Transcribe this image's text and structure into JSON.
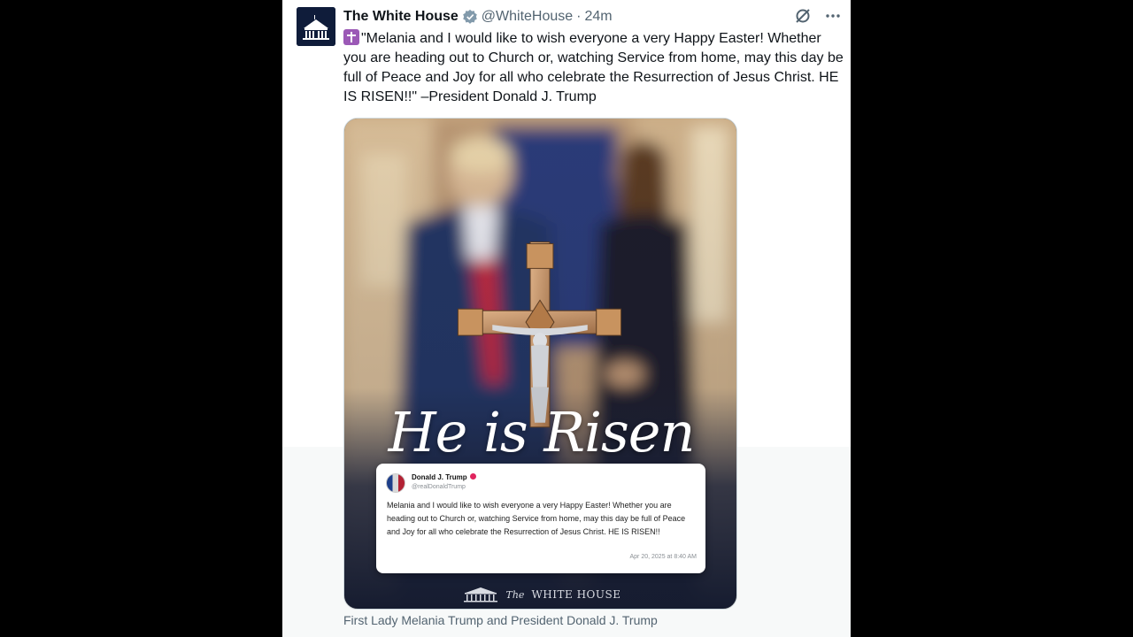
{
  "tweet": {
    "author_name": "The White House",
    "author_handle": "@WhiteHouse",
    "separator": "·",
    "timestamp": "24m",
    "text": "\"Melania and I would like to wish everyone a very Happy Easter! Whether you are heading out to Church or, watching Service from home, may this day be full of Peace and Joy for all who celebrate the Resurrection of Jesus Christ. HE IS RISEN!!\" –President Donald J. Trump",
    "emoji_icon": "latin-cross-emoji",
    "verified_icon": "verified-badge-icon",
    "verified_color": "#829aab"
  },
  "media": {
    "headline": "He is Risen",
    "embedded_post": {
      "name": "Donald J. Trump",
      "handle": "@realDonaldTrump",
      "text": "Melania and I would like to wish everyone a very Happy Easter! Whether you are heading out to Church or, watching Service from home, may this day be full of Peace and Joy for all who celebrate the Resurrection of Jesus Christ. HE IS RISEN!!",
      "date": "Apr 20, 2025 at 8:40 AM"
    },
    "footer_prefix": "The",
    "footer_name": "WHITE HOUSE"
  },
  "caption": "First Lady Melania Trump and President Donald J. Trump",
  "actions": {
    "grok_icon": "grok-icon",
    "more_icon": "more-options-icon"
  },
  "colors": {
    "primary_text": "#0f1419",
    "secondary_text": "#536471",
    "border": "#cfd9de"
  }
}
